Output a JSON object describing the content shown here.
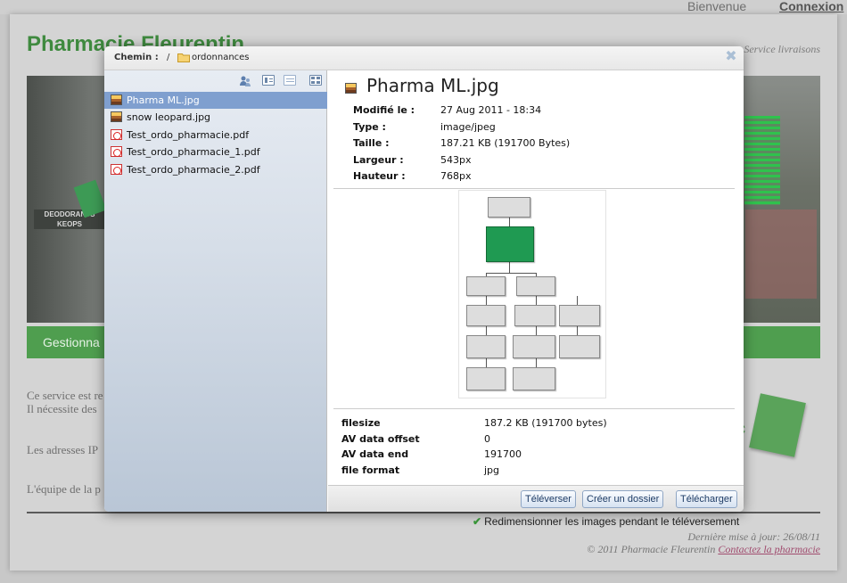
{
  "topbar": {
    "welcome": "Bienvenue",
    "login": "Connexion"
  },
  "site": {
    "title": "Pharmacie Fleurentin",
    "tagline": "Service livraisons",
    "band_text": "Gestionna",
    "para1_line1": "Ce service est re",
    "para1_line2": "Il nécessite des",
    "para2": "Les adresses IP",
    "para3": "L'équipe de la p",
    "shelf_text_1": "DEODORANTS",
    "shelf_text_2": "KEOPS",
    "note_letter": "c"
  },
  "modal": {
    "path_label": "Chemin :",
    "path_sep": "/",
    "path_folder": "ordonnances",
    "close_icon": "close-icon",
    "toolbar_icons": [
      "people-icon",
      "view-list-icon",
      "view-details-icon",
      "view-thumbnails-icon"
    ],
    "files": [
      {
        "name": "Pharma ML.jpg",
        "type": "image",
        "selected": true
      },
      {
        "name": "snow leopard.jpg",
        "type": "image",
        "selected": false
      },
      {
        "name": "Test_ordo_pharmacie.pdf",
        "type": "pdf",
        "selected": false
      },
      {
        "name": "Test_ordo_pharmacie_1.pdf",
        "type": "pdf",
        "selected": false
      },
      {
        "name": "Test_ordo_pharmacie_2.pdf",
        "type": "pdf",
        "selected": false
      }
    ],
    "details": {
      "title": "Pharma ML.jpg",
      "info": [
        {
          "k": "Modifié le :",
          "v": "27 Aug 2011 - 18:34"
        },
        {
          "k": "Type :",
          "v": "image/jpeg"
        },
        {
          "k": "Taille :",
          "v": "187.21 KB (191700 Bytes)"
        },
        {
          "k": "Largeur :",
          "v": "543px"
        },
        {
          "k": "Hauteur :",
          "v": "768px"
        }
      ],
      "meta": [
        {
          "k": "filesize",
          "v": "187.2 KB (191700 bytes)"
        },
        {
          "k": "AV data offset",
          "v": "0"
        },
        {
          "k": "AV data end",
          "v": "191700"
        },
        {
          "k": "file format",
          "v": "jpg"
        }
      ]
    },
    "buttons": {
      "upload": "Téléverser",
      "new_folder": "Créer un dossier",
      "download": "Télécharger"
    }
  },
  "footer": {
    "resize_label": "Redimensionner les images pendant le téléversement",
    "last_update": "Dernière mise à jour: 26/08/11",
    "copyright": "© 2011 Pharmacie Fleurentin",
    "contact_link": "Contactez la pharmacie"
  },
  "colors": {
    "brand_green": "#4f9e4f",
    "selection": "#7f9fcf",
    "button_text": "#1f3d66"
  }
}
